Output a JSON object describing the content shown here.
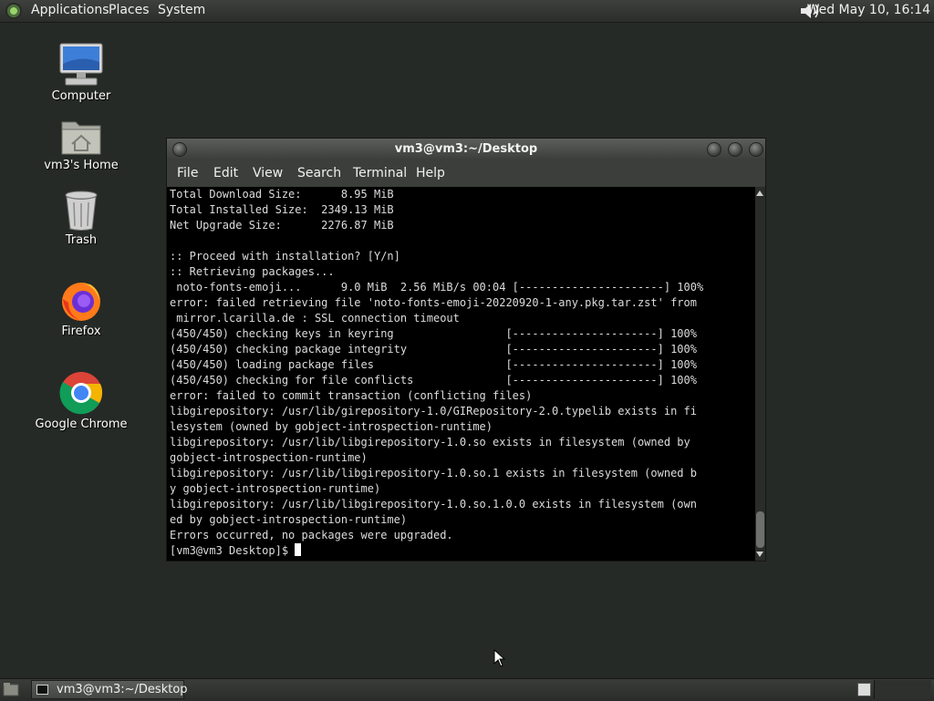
{
  "top_panel": {
    "menus": [
      "Applications",
      "Places",
      "System"
    ],
    "clock": "Wed May 10, 16:14",
    "logo_icon": "distro-logo-icon",
    "volume_icon": "speaker-icon"
  },
  "desktop": {
    "icons": [
      {
        "label": "Computer",
        "icon": "computer-icon"
      },
      {
        "label": "vm3's Home",
        "icon": "home-folder-icon"
      },
      {
        "label": "Trash",
        "icon": "trash-icon"
      },
      {
        "label": "Firefox",
        "icon": "firefox-icon"
      },
      {
        "label": "Google Chrome",
        "icon": "chrome-icon"
      }
    ]
  },
  "terminal": {
    "title": "vm3@vm3:~/Desktop",
    "menu": [
      "File",
      "Edit",
      "View",
      "Search",
      "Terminal",
      "Help"
    ],
    "lines": [
      "Total Download Size:      8.95 MiB",
      "Total Installed Size:  2349.13 MiB",
      "Net Upgrade Size:      2276.87 MiB",
      "",
      ":: Proceed with installation? [Y/n]",
      ":: Retrieving packages...",
      " noto-fonts-emoji...      9.0 MiB  2.56 MiB/s 00:04 [----------------------] 100%",
      "error: failed retrieving file 'noto-fonts-emoji-20220920-1-any.pkg.tar.zst' from",
      " mirror.lcarilla.de : SSL connection timeout",
      "(450/450) checking keys in keyring                 [----------------------] 100%",
      "(450/450) checking package integrity               [----------------------] 100%",
      "(450/450) loading package files                    [----------------------] 100%",
      "(450/450) checking for file conflicts              [----------------------] 100%",
      "error: failed to commit transaction (conflicting files)",
      "libgirepository: /usr/lib/girepository-1.0/GIRepository-2.0.typelib exists in fi",
      "lesystem (owned by gobject-introspection-runtime)",
      "libgirepository: /usr/lib/libgirepository-1.0.so exists in filesystem (owned by",
      "gobject-introspection-runtime)",
      "libgirepository: /usr/lib/libgirepository-1.0.so.1 exists in filesystem (owned b",
      "y gobject-introspection-runtime)",
      "libgirepository: /usr/lib/libgirepository-1.0.so.1.0.0 exists in filesystem (own",
      "ed by gobject-introspection-runtime)",
      "Errors occurred, no packages were upgraded."
    ],
    "prompt": "[vm3@vm3 Desktop]$ "
  },
  "bottom_panel": {
    "task_label": "vm3@vm3:~/Desktop",
    "task_icon": "terminal-icon"
  }
}
